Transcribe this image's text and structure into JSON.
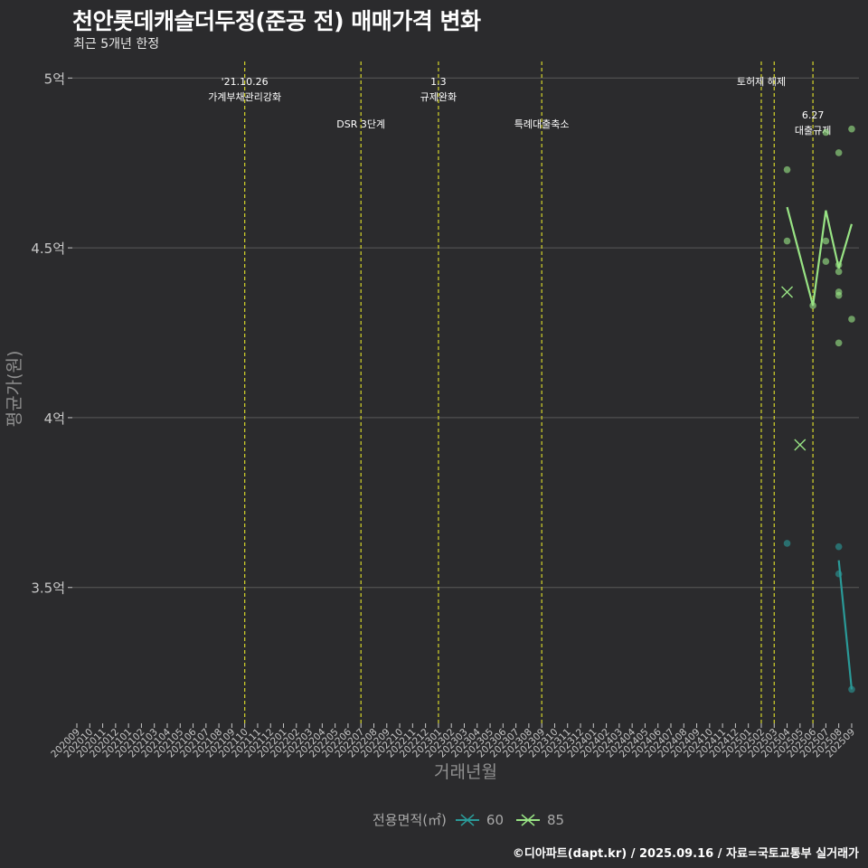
{
  "chart_data": {
    "type": "line",
    "title": "천안롯데캐슬더두정(준공 전) 매매가격 변화",
    "subtitle": "최근 5개년 한정",
    "xlabel": "거래년월",
    "ylabel": "평균가(원)",
    "categories": [
      "202009",
      "202010",
      "202011",
      "202012",
      "202101",
      "202102",
      "202103",
      "202104",
      "202105",
      "202106",
      "202107",
      "202108",
      "202109",
      "202110",
      "202111",
      "202112",
      "202201",
      "202202",
      "202203",
      "202204",
      "202205",
      "202206",
      "202207",
      "202208",
      "202209",
      "202210",
      "202211",
      "202212",
      "202301",
      "202302",
      "202303",
      "202304",
      "202305",
      "202306",
      "202307",
      "202308",
      "202309",
      "202310",
      "202311",
      "202312",
      "202401",
      "202402",
      "202403",
      "202404",
      "202405",
      "202406",
      "202407",
      "202408",
      "202409",
      "202410",
      "202411",
      "202412",
      "202501",
      "202502",
      "202503",
      "202504",
      "202505",
      "202506",
      "202507",
      "202508",
      "202509"
    ],
    "ylim": [
      3.1,
      5.07
    ],
    "yticks": [
      3.5,
      4,
      4.5,
      5
    ],
    "ytick_labels": [
      "3.5억",
      "4억",
      "4.5억",
      "5억"
    ],
    "grid": true,
    "legend_title": "전용면적(㎡)",
    "legend_position": "bottom",
    "series": [
      {
        "name": "60",
        "color": "#2a9a98",
        "line": [
          {
            "x": "202508",
            "y": 3.58
          },
          {
            "x": "202509",
            "y": 3.2
          }
        ],
        "points": [
          {
            "x": "202504",
            "y": 3.63
          },
          {
            "x": "202508",
            "y": 3.62
          },
          {
            "x": "202508",
            "y": 3.54
          },
          {
            "x": "202509",
            "y": 3.2
          }
        ],
        "cross": []
      },
      {
        "name": "85",
        "color": "#98e384",
        "line": [
          {
            "x": "202504",
            "y": 4.62
          },
          {
            "x": "202506",
            "y": 4.33
          },
          {
            "x": "202507",
            "y": 4.61
          },
          {
            "x": "202508",
            "y": 4.44
          },
          {
            "x": "202509",
            "y": 4.57
          }
        ],
        "points": [
          {
            "x": "202504",
            "y": 4.73
          },
          {
            "x": "202504",
            "y": 4.52
          },
          {
            "x": "202506",
            "y": 4.33
          },
          {
            "x": "202507",
            "y": 4.84
          },
          {
            "x": "202507",
            "y": 4.52
          },
          {
            "x": "202507",
            "y": 4.46
          },
          {
            "x": "202508",
            "y": 4.78
          },
          {
            "x": "202508",
            "y": 4.45
          },
          {
            "x": "202508",
            "y": 4.43
          },
          {
            "x": "202508",
            "y": 4.37
          },
          {
            "x": "202508",
            "y": 4.36
          },
          {
            "x": "202508",
            "y": 4.22
          },
          {
            "x": "202509",
            "y": 4.85
          },
          {
            "x": "202509",
            "y": 4.29
          }
        ],
        "cross": [
          {
            "x": "202504",
            "y": 4.37
          },
          {
            "x": "202505",
            "y": 3.92
          }
        ]
      }
    ],
    "events": [
      {
        "x": "202110",
        "lines": [
          "'21.10.26",
          "가계부채관리강화"
        ],
        "row": 1
      },
      {
        "x": "202207",
        "lines": [
          "DSR 3단계"
        ],
        "row": 2
      },
      {
        "x": "202301",
        "lines": [
          "1.3",
          "규제완화"
        ],
        "row": 1
      },
      {
        "x": "202309",
        "lines": [
          "특례대출축소"
        ],
        "row": 2
      },
      {
        "x": "202502",
        "lines": [
          "토허제 해제"
        ],
        "row": 1
      },
      {
        "x": "202503",
        "lines": [],
        "row": 0
      },
      {
        "x": "202506",
        "lines": [
          "6.27",
          "대출규제"
        ],
        "row": 3
      }
    ]
  },
  "caption": "©디아파트(dapt.kr) / 2025.09.16 / 자료=국토교통부 실거래가",
  "colors": {
    "background": "#2b2b2d",
    "grid": "#5a5a5a",
    "event_line": "#d6d62a",
    "axis_text": "#c8c8c8"
  }
}
